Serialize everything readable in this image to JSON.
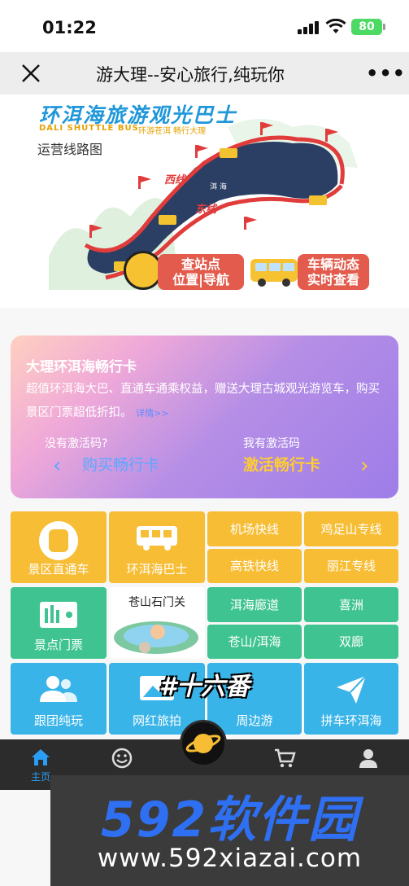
{
  "status_bar": {
    "time": "01:22",
    "battery": "80"
  },
  "nav": {
    "title": "游大理--安心旅行,纯玩你"
  },
  "map": {
    "title": "环洱海旅游观光巴士",
    "subtitle_en": "DALI SHUTTLE BUS",
    "subtitle_cn": "环游苍洱 畅行大理",
    "label": "运营线路图",
    "lake": "洱 海",
    "west_line": "西线",
    "east_line": "东线",
    "btn_station": [
      "查站点",
      "位置|导航"
    ],
    "btn_vehicle": [
      "车辆动态",
      "实时查看"
    ]
  },
  "card": {
    "title": "大理环洱海畅行卡",
    "desc": "超值环洱海大巴、直通车通乘权益，赠送大理古城观光游览车，购买景区门票超低折扣。",
    "more": "详情>>",
    "left_question": "没有激活码?",
    "left_button": "购买畅行卡",
    "right_question": "我有激活码",
    "right_button": "激活畅行卡"
  },
  "grid": {
    "scenic_bus": "景区直通车",
    "erhai_bus": "环洱海巴士",
    "airport": "机场快线",
    "jizushan": "鸡足山专线",
    "highspeed": "高铁快线",
    "lijiang": "丽江专线",
    "tickets": "景点门票",
    "cangshan_gate": "苍山石门关",
    "erhai_corridor": "洱海廊道",
    "xizhou": "喜洲",
    "cangshan_erhai": "苍山/洱海",
    "shuanglang": "双廊",
    "group_tour": "跟团纯玩",
    "photo": "网红旅拍",
    "surroundings": "周边游",
    "carpool": "拼车环洱海",
    "tag": "#十六番"
  },
  "tabbar": {
    "home": "主页"
  },
  "watermark": {
    "big": "592软件园",
    "url": "www.592xiazai.com"
  },
  "colors": {
    "yellow": "#f7bd34",
    "green": "#3fc491",
    "blue": "#39b4e8",
    "accent": "#2a9df4"
  }
}
